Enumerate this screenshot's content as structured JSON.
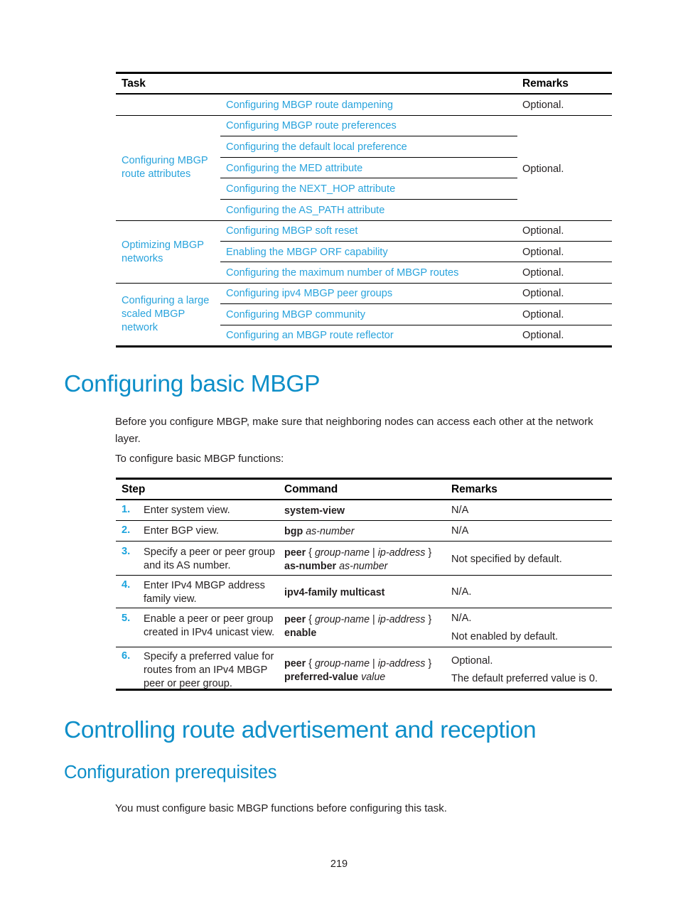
{
  "page": {
    "number": "219",
    "accent_heading": "#0d8ec8",
    "accent_link": "#29a3dc",
    "accent_step": "#1ba3dd",
    "text_color": "#231f20"
  },
  "task_table": {
    "headers": {
      "task": "Task",
      "remarks": "Remarks"
    },
    "rows": [
      {
        "group": "",
        "items": [
          "Configuring MBGP route dampening"
        ],
        "remarks": [
          "Optional."
        ]
      },
      {
        "group": "Configuring MBGP route attributes",
        "items": [
          "Configuring MBGP route preferences",
          "Configuring the default local preference",
          "Configuring the MED attribute",
          "Configuring the NEXT_HOP attribute",
          "Configuring the AS_PATH attribute"
        ],
        "remarks": [
          "Optional."
        ]
      },
      {
        "group": "Optimizing MBGP networks",
        "items": [
          "Configuring MBGP soft reset",
          "Enabling the MBGP ORF capability",
          "Configuring the maximum number of MBGP routes"
        ],
        "remarks": [
          "Optional.",
          "Optional.",
          "Optional."
        ]
      },
      {
        "group": "Configuring a large scaled MBGP network",
        "items": [
          "Configuring ipv4 MBGP peer groups",
          "Configuring MBGP community",
          "Configuring an MBGP route reflector"
        ],
        "remarks": [
          "Optional.",
          "Optional.",
          "Optional."
        ]
      }
    ]
  },
  "section_basic_mbgp": {
    "heading": "Configuring basic MBGP",
    "intro": "Before you configure MBGP, make sure that neighboring nodes can access each other at the network layer.",
    "lead_in": "To configure basic MBGP functions:"
  },
  "steps_table": {
    "headers": {
      "step": "Step",
      "command": "Command",
      "remarks": "Remarks"
    },
    "rows": [
      {
        "num": "1.",
        "desc": "Enter system view.",
        "command_html": "<b>system-view</b>",
        "remarks": [
          "N/A"
        ]
      },
      {
        "num": "2.",
        "desc": "Enter BGP view.",
        "command_html": "<b>bgp</b> <i>as-number</i>",
        "remarks": [
          "N/A"
        ]
      },
      {
        "num": "3.",
        "desc": "Specify a peer or peer group and its AS number.",
        "command_html": "<b>peer</b> { <i>group-name</i> | <i>ip-address</i> }<br><b>as-number</b> <i>as-number</i>",
        "remarks": [
          "Not specified by default."
        ]
      },
      {
        "num": "4.",
        "desc": "Enter IPv4 MBGP address family view.",
        "command_html": "<b>ipv4-family multicast</b>",
        "remarks": [
          "N/A."
        ]
      },
      {
        "num": "5.",
        "desc": "Enable a peer or peer group created in IPv4 unicast view.",
        "command_html": "<b>peer</b> { <i>group-name</i> | <i>ip-address</i> }<br><b>enable</b>",
        "remarks": [
          "N/A.",
          "Not enabled by default."
        ]
      },
      {
        "num": "6.",
        "desc": "Specify a preferred value for routes from an IPv4 MBGP peer or peer group.",
        "command_html": "<b>peer</b> { <i>group-name</i> | <i>ip-address</i> }<br><b>preferred-value</b> <i>value</i>",
        "remarks": [
          "Optional.",
          "The default preferred value is 0."
        ]
      }
    ]
  },
  "section_controlling": {
    "heading": "Controlling route advertisement and reception",
    "subheading": "Configuration prerequisites",
    "body": "You must configure basic MBGP functions before configuring this task."
  }
}
